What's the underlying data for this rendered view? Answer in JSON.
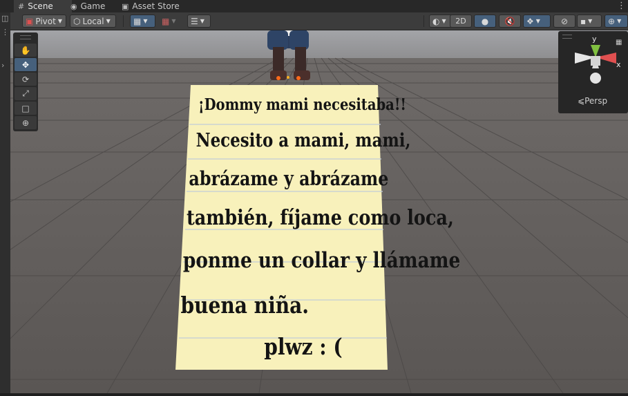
{
  "tabs": [
    {
      "label": "Scene",
      "icon": "scene-grid-icon",
      "active": true
    },
    {
      "label": "Game",
      "icon": "gamepad-icon",
      "active": false
    },
    {
      "label": "Asset Store",
      "icon": "shopping-bag-icon",
      "active": false
    }
  ],
  "toolbar": {
    "pivot_label": "Pivot",
    "local_label": "Local",
    "mode_2d_label": "2D"
  },
  "tools": [
    {
      "name": "hand-tool",
      "icon": "hand-icon",
      "selected": false
    },
    {
      "name": "move-tool",
      "icon": "move-arrows-icon",
      "selected": true
    },
    {
      "name": "rotate-tool",
      "icon": "rotate-icon",
      "selected": false
    },
    {
      "name": "scale-tool",
      "icon": "scale-icon",
      "selected": false
    },
    {
      "name": "rect-tool",
      "icon": "rect-transform-icon",
      "selected": false
    },
    {
      "name": "transform-tool",
      "icon": "transform-icon",
      "selected": false
    }
  ],
  "gizmo": {
    "y_label": "y",
    "x_label": "x",
    "projection_label": "Persp"
  },
  "note": {
    "lines": [
      "¡Dommy mami necesitaba!!",
      "Necesito a mami, mami,",
      "abrázame y abrázame",
      "también, fíjame como loca,",
      "ponme un collar y llámame",
      "buena niña."
    ],
    "signature": "plwz : ("
  },
  "colors": {
    "accent": "#46607c",
    "paper": "#f8f1bb",
    "ink": "#141414",
    "axis_x": "#e05050",
    "axis_y": "#80c040"
  }
}
